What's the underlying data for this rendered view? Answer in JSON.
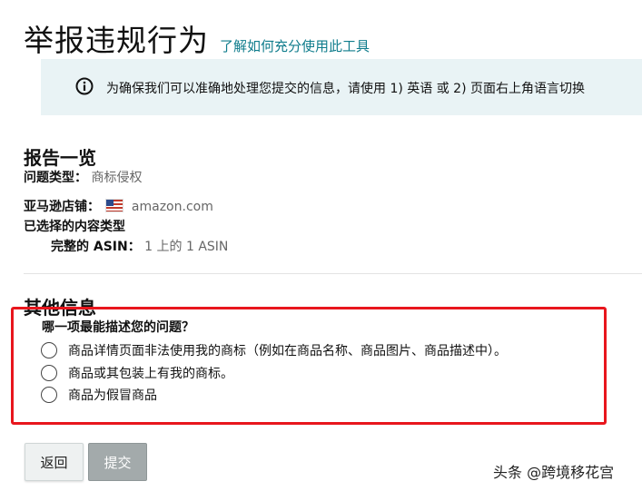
{
  "header": {
    "title": "举报违规行为",
    "help_link": "了解如何充分使用此工具"
  },
  "info_banner": {
    "icon": "info-icon",
    "text": "为确保我们可以准确地处理您提交的信息，请使用 1) 英语 或 2) 页面右上角语言切换"
  },
  "summary": {
    "title": "报告一览",
    "issue_type_label": "问题类型：",
    "issue_type_value": "商标侵权",
    "store_label": "亚马逊店铺：",
    "store_flag": "us-flag-icon",
    "store_value": "amazon.com",
    "content_type_label": "已选择的内容类型",
    "asin_label": "完整的 ASIN：",
    "asin_value": "1 上的 1 ASIN"
  },
  "other_info": {
    "title": "其他信息",
    "question": "哪一项最能描述您的问题？",
    "options": [
      "商品详情页面非法使用我的商标（例如在商品名称、商品图片、商品描述中）。",
      "商品或其包装上有我的商标。",
      "商品为假冒商品"
    ]
  },
  "actions": {
    "back_label": "返回",
    "submit_label": "提交"
  },
  "watermark": "头条 @跨境移花宫",
  "colors": {
    "link": "#0f7c8c",
    "info_bg": "#e9f3f5",
    "highlight_border": "#e8161d",
    "submit_bg": "#a3aaab"
  }
}
